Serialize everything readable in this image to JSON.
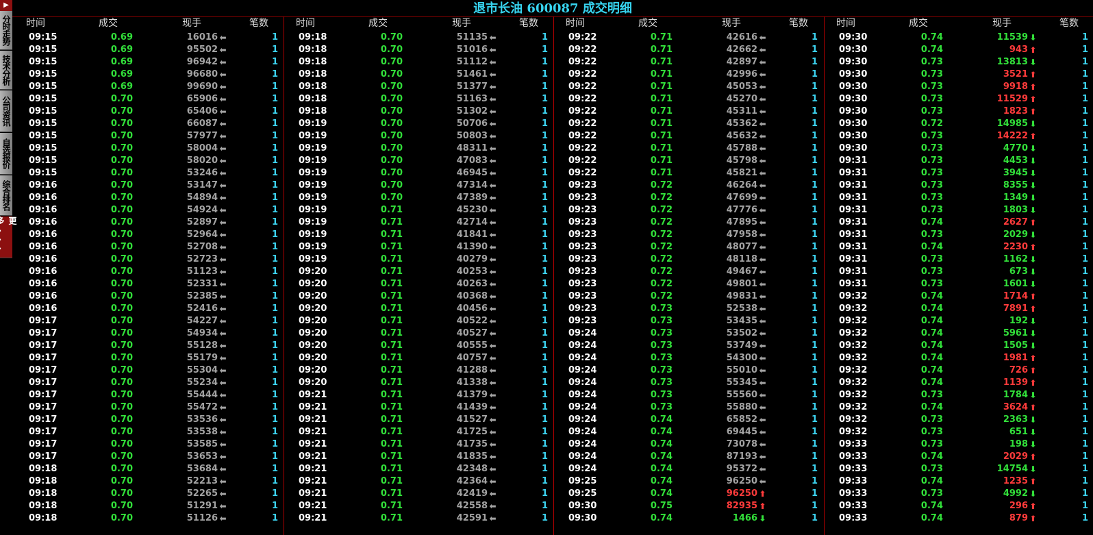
{
  "title": "退市长油 600087 成交明细",
  "headers": {
    "time": "时间",
    "price": "成交",
    "volume": "现手",
    "count": "笔数"
  },
  "sidebar": {
    "top_icon": "exit-icon",
    "tabs": [
      "分时走势",
      "技术分析",
      "公司资讯",
      "自选报价",
      "综合排名"
    ],
    "more": "更多..."
  },
  "colors": {
    "up": "#ff3b3b",
    "down": "#32e03a",
    "neutral": "#a3a3a3",
    "title": "#37d4f0",
    "count": "#3cd3f0"
  },
  "columns": [
    [
      [
        "09:15",
        "0.69",
        "16016",
        "n",
        "1"
      ],
      [
        "09:15",
        "0.69",
        "95502",
        "n",
        "1"
      ],
      [
        "09:15",
        "0.69",
        "96942",
        "n",
        "1"
      ],
      [
        "09:15",
        "0.69",
        "96680",
        "n",
        "1"
      ],
      [
        "09:15",
        "0.69",
        "99690",
        "n",
        "1"
      ],
      [
        "09:15",
        "0.70",
        "65906",
        "n",
        "1"
      ],
      [
        "09:15",
        "0.70",
        "65406",
        "n",
        "1"
      ],
      [
        "09:15",
        "0.70",
        "66087",
        "n",
        "1"
      ],
      [
        "09:15",
        "0.70",
        "57977",
        "n",
        "1"
      ],
      [
        "09:15",
        "0.70",
        "58004",
        "n",
        "1"
      ],
      [
        "09:15",
        "0.70",
        "58020",
        "n",
        "1"
      ],
      [
        "09:15",
        "0.70",
        "53246",
        "n",
        "1"
      ],
      [
        "09:16",
        "0.70",
        "53147",
        "n",
        "1"
      ],
      [
        "09:16",
        "0.70",
        "54894",
        "n",
        "1"
      ],
      [
        "09:16",
        "0.70",
        "54924",
        "n",
        "1"
      ],
      [
        "09:16",
        "0.70",
        "52897",
        "n",
        "1"
      ],
      [
        "09:16",
        "0.70",
        "52964",
        "n",
        "1"
      ],
      [
        "09:16",
        "0.70",
        "52708",
        "n",
        "1"
      ],
      [
        "09:16",
        "0.70",
        "52723",
        "n",
        "1"
      ],
      [
        "09:16",
        "0.70",
        "51123",
        "n",
        "1"
      ],
      [
        "09:16",
        "0.70",
        "52331",
        "n",
        "1"
      ],
      [
        "09:16",
        "0.70",
        "52385",
        "n",
        "1"
      ],
      [
        "09:16",
        "0.70",
        "52416",
        "n",
        "1"
      ],
      [
        "09:17",
        "0.70",
        "54227",
        "n",
        "1"
      ],
      [
        "09:17",
        "0.70",
        "54934",
        "n",
        "1"
      ],
      [
        "09:17",
        "0.70",
        "55128",
        "n",
        "1"
      ],
      [
        "09:17",
        "0.70",
        "55179",
        "n",
        "1"
      ],
      [
        "09:17",
        "0.70",
        "55304",
        "n",
        "1"
      ],
      [
        "09:17",
        "0.70",
        "55234",
        "n",
        "1"
      ],
      [
        "09:17",
        "0.70",
        "55444",
        "n",
        "1"
      ],
      [
        "09:17",
        "0.70",
        "55472",
        "n",
        "1"
      ],
      [
        "09:17",
        "0.70",
        "53536",
        "n",
        "1"
      ],
      [
        "09:17",
        "0.70",
        "53538",
        "n",
        "1"
      ],
      [
        "09:17",
        "0.70",
        "53585",
        "n",
        "1"
      ],
      [
        "09:17",
        "0.70",
        "53653",
        "n",
        "1"
      ],
      [
        "09:18",
        "0.70",
        "53684",
        "n",
        "1"
      ],
      [
        "09:18",
        "0.70",
        "52213",
        "n",
        "1"
      ],
      [
        "09:18",
        "0.70",
        "52265",
        "n",
        "1"
      ],
      [
        "09:18",
        "0.70",
        "51291",
        "n",
        "1"
      ],
      [
        "09:18",
        "0.70",
        "51126",
        "n",
        "1"
      ]
    ],
    [
      [
        "09:18",
        "0.70",
        "51135",
        "n",
        "1"
      ],
      [
        "09:18",
        "0.70",
        "51016",
        "n",
        "1"
      ],
      [
        "09:18",
        "0.70",
        "51112",
        "n",
        "1"
      ],
      [
        "09:18",
        "0.70",
        "51461",
        "n",
        "1"
      ],
      [
        "09:18",
        "0.70",
        "51377",
        "n",
        "1"
      ],
      [
        "09:18",
        "0.70",
        "51163",
        "n",
        "1"
      ],
      [
        "09:18",
        "0.70",
        "51302",
        "n",
        "1"
      ],
      [
        "09:19",
        "0.70",
        "50706",
        "n",
        "1"
      ],
      [
        "09:19",
        "0.70",
        "50803",
        "n",
        "1"
      ],
      [
        "09:19",
        "0.70",
        "48311",
        "n",
        "1"
      ],
      [
        "09:19",
        "0.70",
        "47083",
        "n",
        "1"
      ],
      [
        "09:19",
        "0.70",
        "46945",
        "n",
        "1"
      ],
      [
        "09:19",
        "0.70",
        "47314",
        "n",
        "1"
      ],
      [
        "09:19",
        "0.70",
        "47389",
        "n",
        "1"
      ],
      [
        "09:19",
        "0.71",
        "45230",
        "n",
        "1"
      ],
      [
        "09:19",
        "0.71",
        "42714",
        "n",
        "1"
      ],
      [
        "09:19",
        "0.71",
        "41841",
        "n",
        "1"
      ],
      [
        "09:19",
        "0.71",
        "41390",
        "n",
        "1"
      ],
      [
        "09:19",
        "0.71",
        "40279",
        "n",
        "1"
      ],
      [
        "09:20",
        "0.71",
        "40253",
        "n",
        "1"
      ],
      [
        "09:20",
        "0.71",
        "40263",
        "n",
        "1"
      ],
      [
        "09:20",
        "0.71",
        "40368",
        "n",
        "1"
      ],
      [
        "09:20",
        "0.71",
        "40456",
        "n",
        "1"
      ],
      [
        "09:20",
        "0.71",
        "40522",
        "n",
        "1"
      ],
      [
        "09:20",
        "0.71",
        "40527",
        "n",
        "1"
      ],
      [
        "09:20",
        "0.71",
        "40555",
        "n",
        "1"
      ],
      [
        "09:20",
        "0.71",
        "40757",
        "n",
        "1"
      ],
      [
        "09:20",
        "0.71",
        "41288",
        "n",
        "1"
      ],
      [
        "09:20",
        "0.71",
        "41338",
        "n",
        "1"
      ],
      [
        "09:21",
        "0.71",
        "41379",
        "n",
        "1"
      ],
      [
        "09:21",
        "0.71",
        "41439",
        "n",
        "1"
      ],
      [
        "09:21",
        "0.71",
        "41527",
        "n",
        "1"
      ],
      [
        "09:21",
        "0.71",
        "41725",
        "n",
        "1"
      ],
      [
        "09:21",
        "0.71",
        "41735",
        "n",
        "1"
      ],
      [
        "09:21",
        "0.71",
        "41835",
        "n",
        "1"
      ],
      [
        "09:21",
        "0.71",
        "42348",
        "n",
        "1"
      ],
      [
        "09:21",
        "0.71",
        "42364",
        "n",
        "1"
      ],
      [
        "09:21",
        "0.71",
        "42419",
        "n",
        "1"
      ],
      [
        "09:21",
        "0.71",
        "42558",
        "n",
        "1"
      ],
      [
        "09:21",
        "0.71",
        "42591",
        "n",
        "1"
      ]
    ],
    [
      [
        "09:22",
        "0.71",
        "42616",
        "n",
        "1"
      ],
      [
        "09:22",
        "0.71",
        "42662",
        "n",
        "1"
      ],
      [
        "09:22",
        "0.71",
        "42897",
        "n",
        "1"
      ],
      [
        "09:22",
        "0.71",
        "42996",
        "n",
        "1"
      ],
      [
        "09:22",
        "0.71",
        "45053",
        "n",
        "1"
      ],
      [
        "09:22",
        "0.71",
        "45270",
        "n",
        "1"
      ],
      [
        "09:22",
        "0.71",
        "45311",
        "n",
        "1"
      ],
      [
        "09:22",
        "0.71",
        "45362",
        "n",
        "1"
      ],
      [
        "09:22",
        "0.71",
        "45632",
        "n",
        "1"
      ],
      [
        "09:22",
        "0.71",
        "45788",
        "n",
        "1"
      ],
      [
        "09:22",
        "0.71",
        "45798",
        "n",
        "1"
      ],
      [
        "09:22",
        "0.71",
        "45821",
        "n",
        "1"
      ],
      [
        "09:23",
        "0.72",
        "46264",
        "n",
        "1"
      ],
      [
        "09:23",
        "0.72",
        "47699",
        "n",
        "1"
      ],
      [
        "09:23",
        "0.72",
        "47776",
        "n",
        "1"
      ],
      [
        "09:23",
        "0.72",
        "47895",
        "n",
        "1"
      ],
      [
        "09:23",
        "0.72",
        "47958",
        "n",
        "1"
      ],
      [
        "09:23",
        "0.72",
        "48077",
        "n",
        "1"
      ],
      [
        "09:23",
        "0.72",
        "48118",
        "n",
        "1"
      ],
      [
        "09:23",
        "0.72",
        "49467",
        "n",
        "1"
      ],
      [
        "09:23",
        "0.72",
        "49801",
        "n",
        "1"
      ],
      [
        "09:23",
        "0.72",
        "49831",
        "n",
        "1"
      ],
      [
        "09:23",
        "0.73",
        "52538",
        "n",
        "1"
      ],
      [
        "09:23",
        "0.73",
        "53435",
        "n",
        "1"
      ],
      [
        "09:24",
        "0.73",
        "53502",
        "n",
        "1"
      ],
      [
        "09:24",
        "0.73",
        "53749",
        "n",
        "1"
      ],
      [
        "09:24",
        "0.73",
        "54300",
        "n",
        "1"
      ],
      [
        "09:24",
        "0.73",
        "55010",
        "n",
        "1"
      ],
      [
        "09:24",
        "0.73",
        "55345",
        "n",
        "1"
      ],
      [
        "09:24",
        "0.73",
        "55560",
        "n",
        "1"
      ],
      [
        "09:24",
        "0.73",
        "55880",
        "n",
        "1"
      ],
      [
        "09:24",
        "0.74",
        "65852",
        "n",
        "1"
      ],
      [
        "09:24",
        "0.74",
        "69445",
        "n",
        "1"
      ],
      [
        "09:24",
        "0.74",
        "73078",
        "n",
        "1"
      ],
      [
        "09:24",
        "0.74",
        "87193",
        "n",
        "1"
      ],
      [
        "09:24",
        "0.74",
        "95372",
        "n",
        "1"
      ],
      [
        "09:25",
        "0.74",
        "96250",
        "n",
        "1"
      ],
      [
        "09:25",
        "0.74",
        "96250",
        "u",
        "1"
      ],
      [
        "09:30",
        "0.75",
        "82935",
        "u",
        "1"
      ],
      [
        "09:30",
        "0.74",
        "1466",
        "d",
        "1"
      ]
    ],
    [
      [
        "09:30",
        "0.74",
        "11539",
        "d",
        "1"
      ],
      [
        "09:30",
        "0.74",
        "943",
        "u",
        "1"
      ],
      [
        "09:30",
        "0.73",
        "13813",
        "d",
        "1"
      ],
      [
        "09:30",
        "0.73",
        "3521",
        "u",
        "1"
      ],
      [
        "09:30",
        "0.73",
        "9918",
        "u",
        "1"
      ],
      [
        "09:30",
        "0.73",
        "11529",
        "u",
        "1"
      ],
      [
        "09:30",
        "0.73",
        "1823",
        "u",
        "1"
      ],
      [
        "09:30",
        "0.72",
        "14985",
        "d",
        "1"
      ],
      [
        "09:30",
        "0.73",
        "14222",
        "u",
        "1"
      ],
      [
        "09:30",
        "0.73",
        "4770",
        "d",
        "1"
      ],
      [
        "09:31",
        "0.73",
        "4453",
        "d",
        "1"
      ],
      [
        "09:31",
        "0.73",
        "3945",
        "d",
        "1"
      ],
      [
        "09:31",
        "0.73",
        "8355",
        "d",
        "1"
      ],
      [
        "09:31",
        "0.73",
        "1349",
        "d",
        "1"
      ],
      [
        "09:31",
        "0.73",
        "1803",
        "d",
        "1"
      ],
      [
        "09:31",
        "0.74",
        "2627",
        "u",
        "1"
      ],
      [
        "09:31",
        "0.73",
        "2029",
        "d",
        "1"
      ],
      [
        "09:31",
        "0.74",
        "2230",
        "u",
        "1"
      ],
      [
        "09:31",
        "0.73",
        "1162",
        "d",
        "1"
      ],
      [
        "09:31",
        "0.73",
        "673",
        "d",
        "1"
      ],
      [
        "09:31",
        "0.73",
        "1601",
        "d",
        "1"
      ],
      [
        "09:32",
        "0.74",
        "1714",
        "u",
        "1"
      ],
      [
        "09:32",
        "0.74",
        "7891",
        "u",
        "1"
      ],
      [
        "09:32",
        "0.74",
        "192",
        "d",
        "1"
      ],
      [
        "09:32",
        "0.74",
        "5961",
        "d",
        "1"
      ],
      [
        "09:32",
        "0.74",
        "1505",
        "d",
        "1"
      ],
      [
        "09:32",
        "0.74",
        "1981",
        "u",
        "1"
      ],
      [
        "09:32",
        "0.74",
        "726",
        "u",
        "1"
      ],
      [
        "09:32",
        "0.74",
        "1139",
        "u",
        "1"
      ],
      [
        "09:32",
        "0.73",
        "1784",
        "d",
        "1"
      ],
      [
        "09:32",
        "0.74",
        "3624",
        "u",
        "1"
      ],
      [
        "09:32",
        "0.73",
        "2363",
        "d",
        "1"
      ],
      [
        "09:32",
        "0.73",
        "651",
        "d",
        "1"
      ],
      [
        "09:33",
        "0.73",
        "198",
        "d",
        "1"
      ],
      [
        "09:33",
        "0.74",
        "2029",
        "u",
        "1"
      ],
      [
        "09:33",
        "0.73",
        "14754",
        "d",
        "1"
      ],
      [
        "09:33",
        "0.74",
        "1235",
        "u",
        "1"
      ],
      [
        "09:33",
        "0.73",
        "4992",
        "d",
        "1"
      ],
      [
        "09:33",
        "0.74",
        "296",
        "u",
        "1"
      ],
      [
        "09:33",
        "0.74",
        "879",
        "u",
        "1"
      ]
    ]
  ]
}
